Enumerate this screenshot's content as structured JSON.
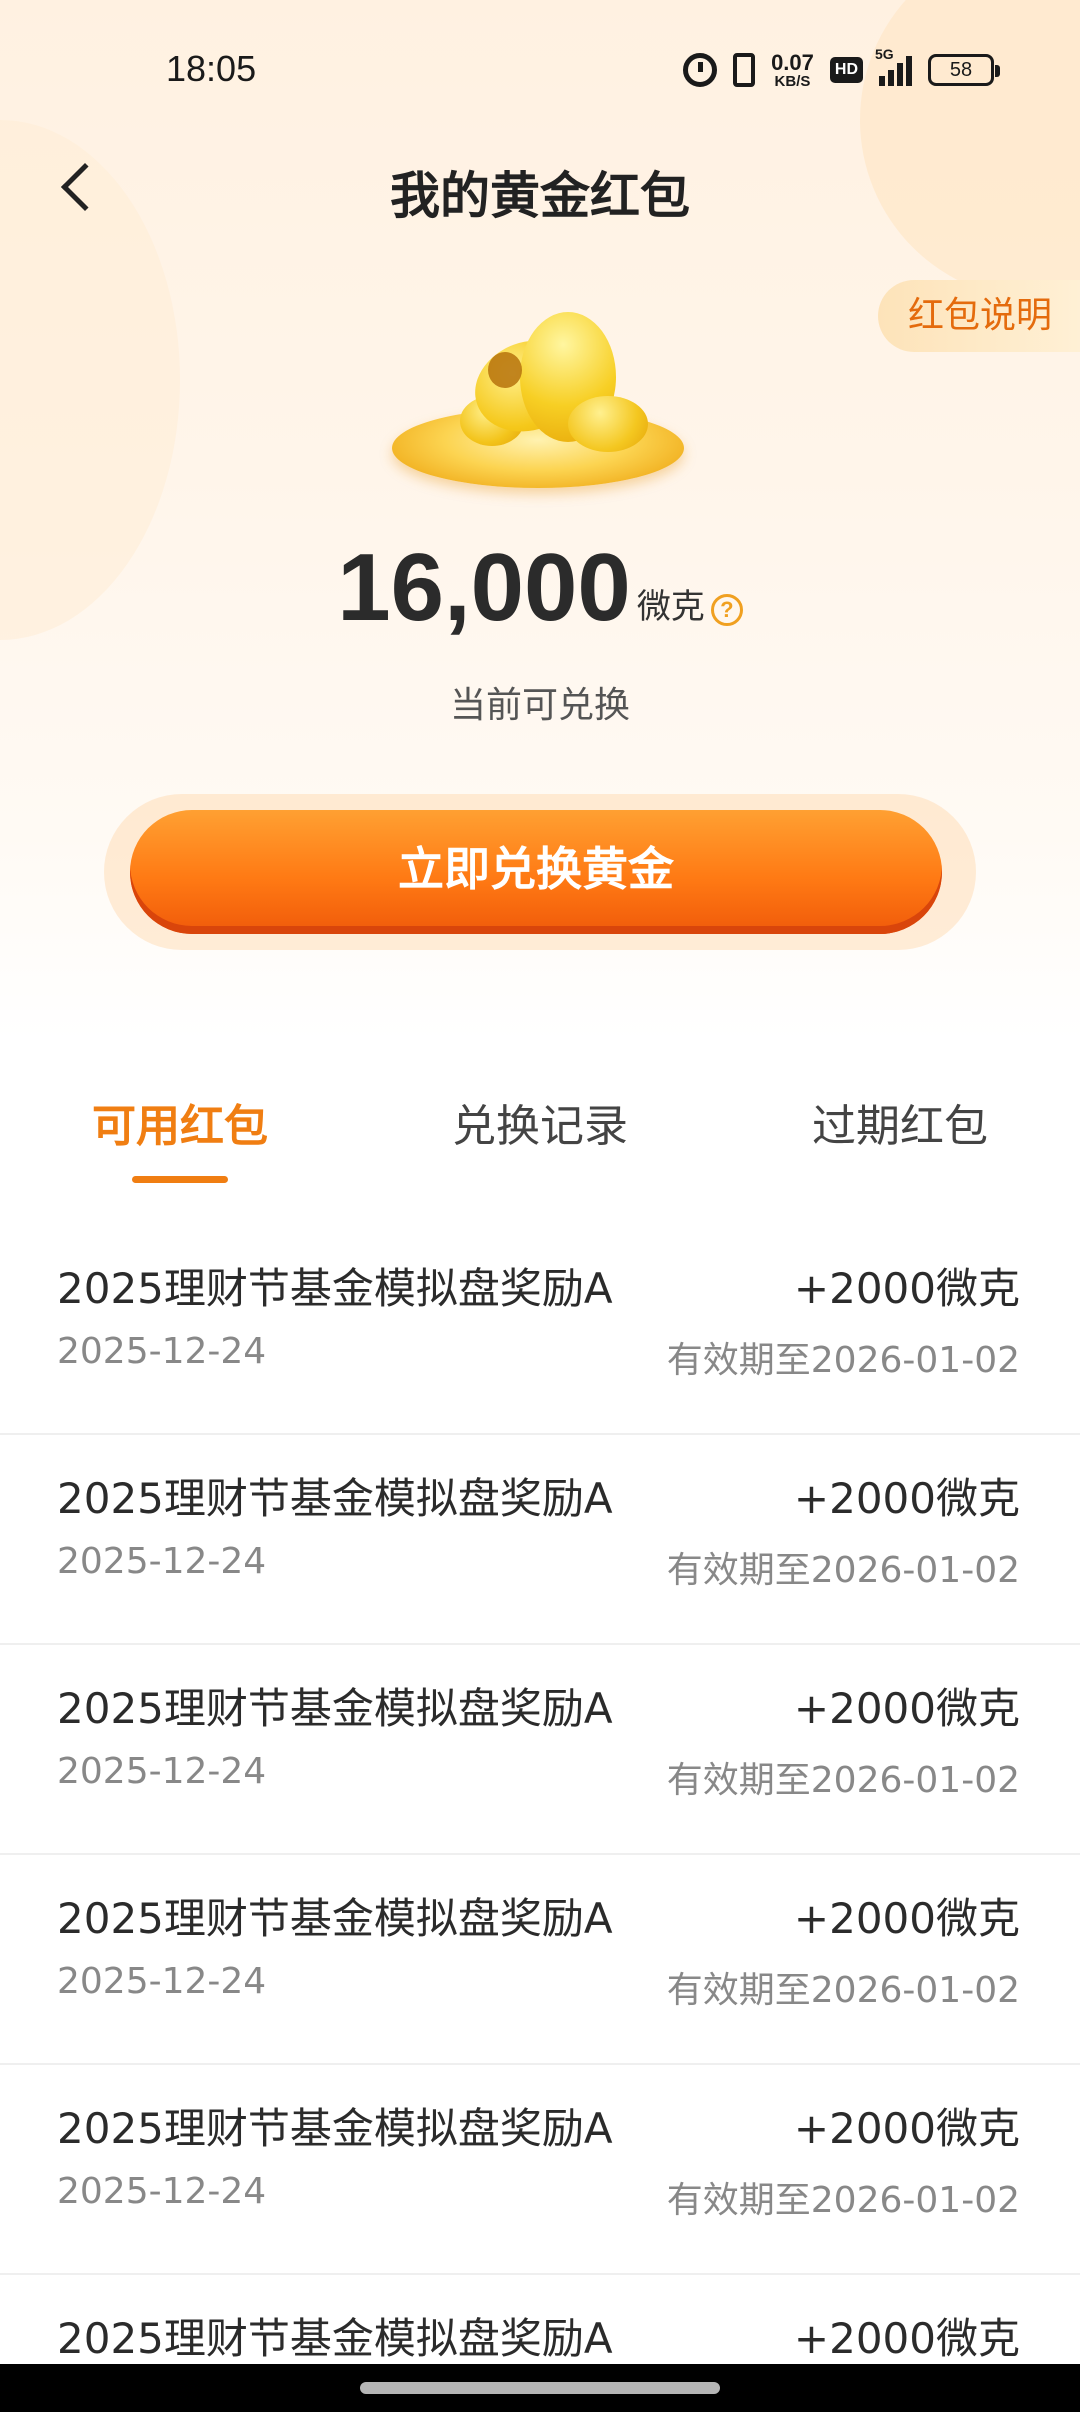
{
  "status_bar": {
    "time": "18:05",
    "net_speed_value": "0.07",
    "net_speed_unit": "KB/S",
    "hd_label": "HD",
    "network_label": "5G",
    "battery_level": "58"
  },
  "header": {
    "title": "我的黄金红包",
    "rule_label": "红包说明"
  },
  "balance": {
    "amount": "16,000",
    "unit": "微克",
    "subtitle": "当前可兑换",
    "help_glyph": "?"
  },
  "cta": {
    "label": "立即兑换黄金"
  },
  "tabs": [
    {
      "label": "可用红包",
      "active": true
    },
    {
      "label": "兑换记录",
      "active": false
    },
    {
      "label": "过期红包",
      "active": false
    }
  ],
  "records": [
    {
      "title": "2025理财节基金模拟盘奖励A",
      "amount": "+2000微克",
      "date": "2025-12-24",
      "expiry": "有效期至2026-01-02"
    },
    {
      "title": "2025理财节基金模拟盘奖励A",
      "amount": "+2000微克",
      "date": "2025-12-24",
      "expiry": "有效期至2026-01-02"
    },
    {
      "title": "2025理财节基金模拟盘奖励A",
      "amount": "+2000微克",
      "date": "2025-12-24",
      "expiry": "有效期至2026-01-02"
    },
    {
      "title": "2025理财节基金模拟盘奖励A",
      "amount": "+2000微克",
      "date": "2025-12-24",
      "expiry": "有效期至2026-01-02"
    },
    {
      "title": "2025理财节基金模拟盘奖励A",
      "amount": "+2000微克",
      "date": "2025-12-24",
      "expiry": "有效期至2026-01-02"
    },
    {
      "title": "2025理财节基金模拟盘奖励A",
      "amount": "+2000微克",
      "date": "",
      "expiry": ""
    }
  ],
  "theme": {
    "accent": "#f07e12",
    "button_gradient_top": "#ffa032",
    "button_gradient_bottom": "#f05a0a"
  }
}
